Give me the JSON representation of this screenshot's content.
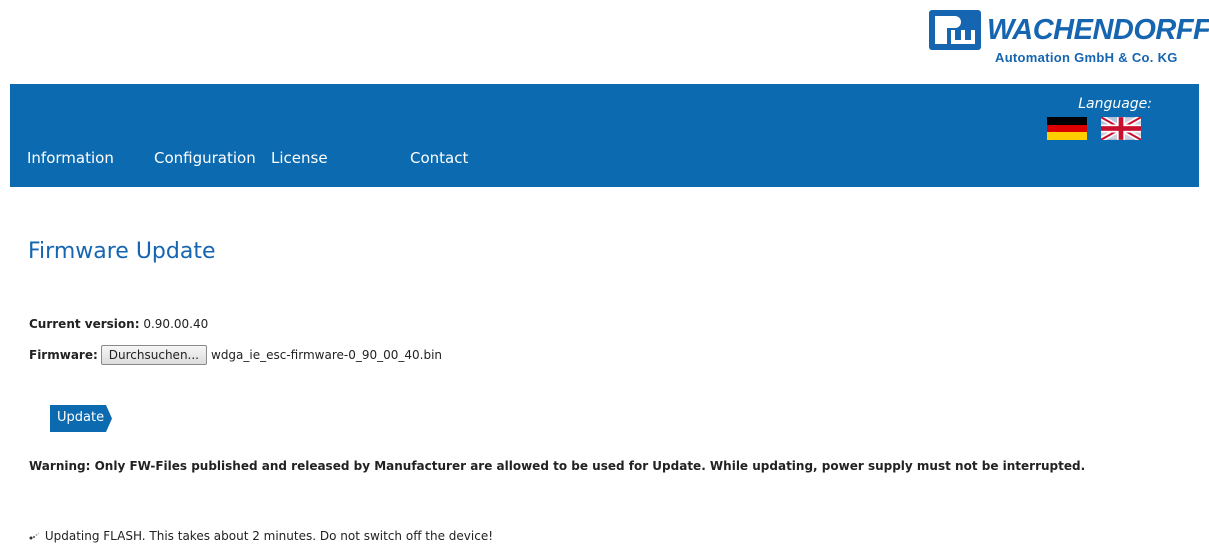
{
  "logo": {
    "name": "WACHENDORFF",
    "subtitle": "Automation GmbH & Co. KG",
    "brand_color": "#1565b0"
  },
  "nav": {
    "bar_color": "#0c6ab0",
    "items": [
      {
        "label": "Information"
      },
      {
        "label": "Configuration"
      },
      {
        "label": "License"
      },
      {
        "label": "Contact"
      }
    ],
    "language_label": "Language:",
    "flags": [
      "german-flag-icon",
      "uk-flag-icon"
    ]
  },
  "page": {
    "title": "Firmware Update",
    "current_version_label": "Current version:",
    "current_version_value": "0.90.00.40",
    "firmware_label": "Firmware:",
    "browse_button": "Durchsuchen...",
    "selected_file": "wdga_ie_esc-firmware-0_90_00_40.bin",
    "update_button": "Update",
    "warning": "Warning: Only FW-Files published and released by Manufacturer are allowed to be used for Update. While updating, power supply must not be interrupted.",
    "status_icon": "loading-spinner-icon",
    "status": "Updating FLASH. This takes about 2 minutes. Do not switch off the device!"
  }
}
